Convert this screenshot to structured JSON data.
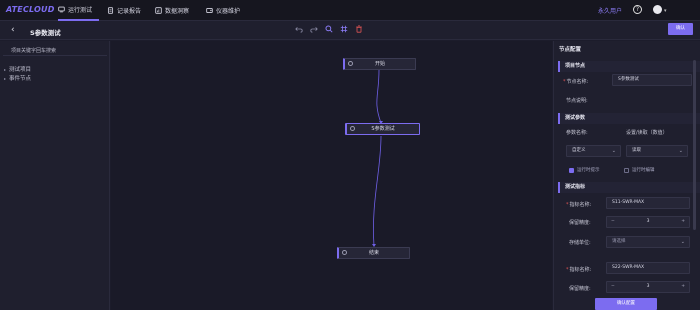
{
  "app": {
    "logo": "ATECLOUD"
  },
  "nav": [
    {
      "label": "运行测试",
      "icon": "monitor-icon"
    },
    {
      "label": "记录报告",
      "icon": "report-icon"
    },
    {
      "label": "数据洞察",
      "icon": "chart-icon"
    },
    {
      "label": "仪器维护",
      "icon": "instrument-icon"
    }
  ],
  "user": {
    "name": "永久用户"
  },
  "toolbar": {
    "title": "S参数测试",
    "confirm_label": "确认"
  },
  "left_panel": {
    "search_placeholder": "项目关键字回车搜索",
    "tree": [
      {
        "label": "测试项目"
      },
      {
        "label": "事件节点"
      }
    ]
  },
  "canvas": {
    "nodes": [
      {
        "label": "开始"
      },
      {
        "label": "S参数测试"
      },
      {
        "label": "结束"
      }
    ]
  },
  "right_panel": {
    "title": "节点配置",
    "section_node": "项目节点",
    "node_name_label": "节点名称:",
    "node_name_value": "S参数测试",
    "node_desc_label": "节点说明:",
    "section_params": "测试参数",
    "param_name_label": "参数名称:",
    "param_setget_label": "设置/读取（数值）",
    "param_select_value": "自定义",
    "param_mode_value": "读取",
    "cb_run_prompt": "运行时提示",
    "cb_run_edit": "运行时编辑",
    "section_indicators": "测试指标",
    "ind1_name_label": "指标名称:",
    "ind1_name_value": "S11-SWR-MAX",
    "ind1_precision_label": "保留精度:",
    "ind1_precision_value": "3",
    "ind1_unit_label": "存储单位:",
    "ind1_unit_placeholder": "请选择",
    "ind2_name_label": "指标名称:",
    "ind2_name_value": "S22-SWR-MAX",
    "ind2_precision_label": "保留精度:",
    "ind2_precision_value": "3",
    "confirm_label": "确认配置"
  }
}
